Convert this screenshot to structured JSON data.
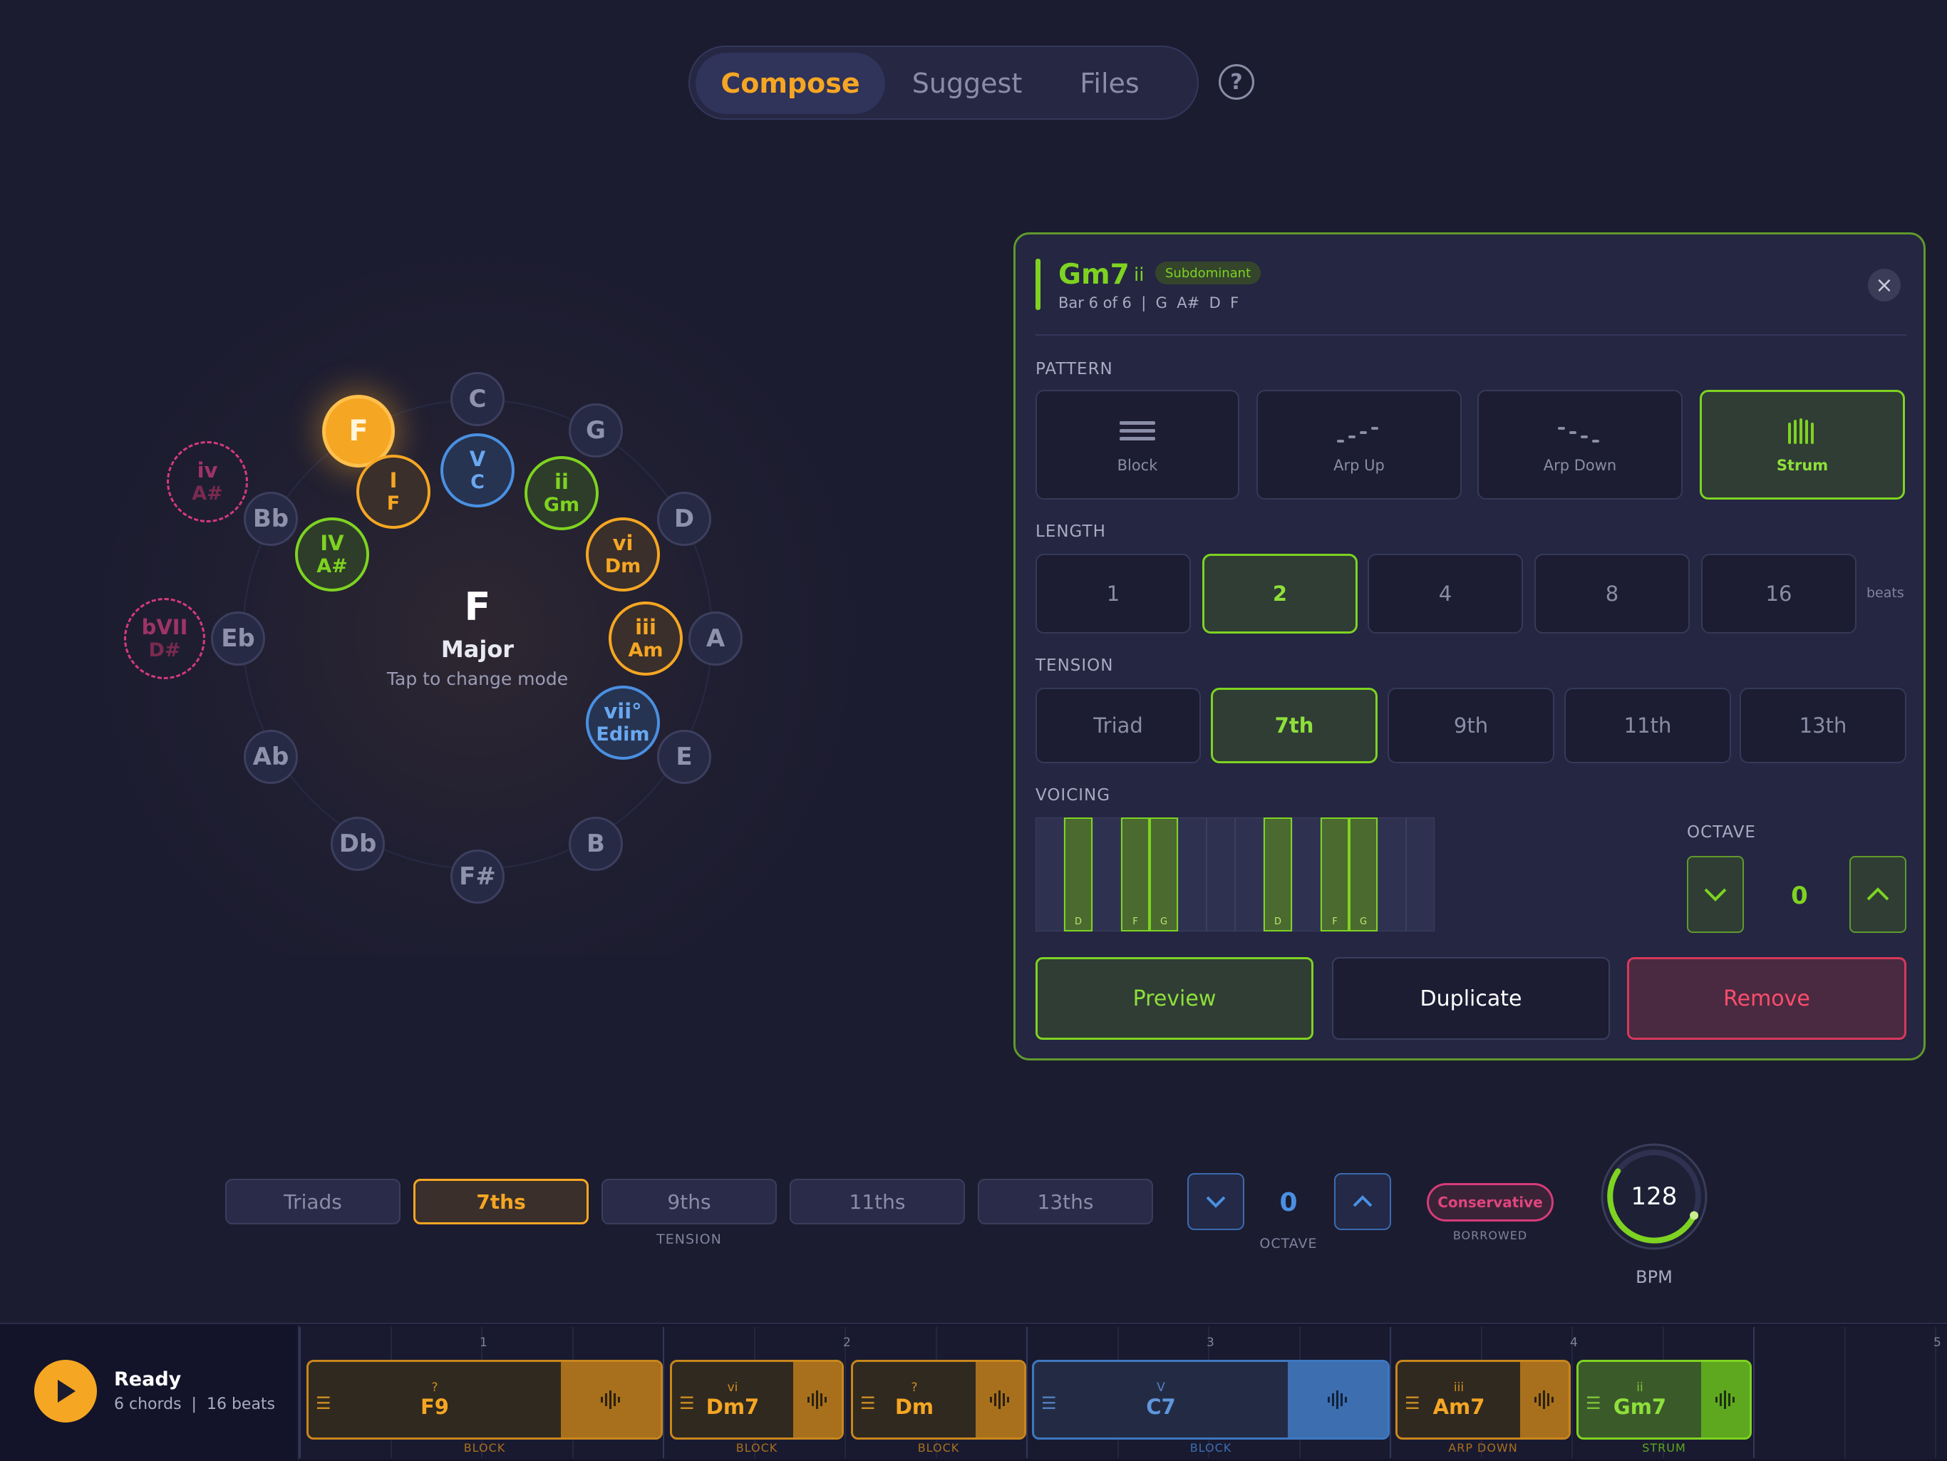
{
  "tabs": [
    {
      "label": "Compose",
      "active": true
    },
    {
      "label": "Suggest",
      "active": false
    },
    {
      "label": "Files",
      "active": false
    }
  ],
  "help": {
    "label": "?"
  },
  "wheel": {
    "keys": [
      "C",
      "G",
      "D",
      "A",
      "E",
      "B",
      "F#",
      "Db",
      "Ab",
      "Eb",
      "Bb",
      "F"
    ],
    "degrees": [
      {
        "roman": "I",
        "chord": "F",
        "color": "orange"
      },
      {
        "roman": "V",
        "chord": "C",
        "color": "blue"
      },
      {
        "roman": "ii",
        "chord": "Gm",
        "color": "green"
      },
      {
        "roman": "vi",
        "chord": "Dm",
        "color": "orange"
      },
      {
        "roman": "iii",
        "chord": "Am",
        "color": "orange"
      },
      {
        "roman": "vii°",
        "chord": "Edim",
        "color": "blue"
      },
      {
        "roman": "IV",
        "chord": "A#",
        "color": "green"
      },
      {
        "roman": "iv",
        "chord": "A#",
        "color": "pink"
      },
      {
        "roman": "bVII",
        "chord": "D#",
        "color": "pink"
      }
    ],
    "center": {
      "key": "F",
      "mode": "Major",
      "hint": "Tap to change mode"
    }
  },
  "panel": {
    "chord": "Gm7",
    "roman": "ii",
    "function": "Subdominant",
    "bar_info": "Bar 6 of 6  |  G  A#  D  F",
    "close": "×",
    "pattern_label": "PATTERN",
    "patterns": [
      {
        "name": "Block"
      },
      {
        "name": "Arp Up"
      },
      {
        "name": "Arp Down"
      },
      {
        "name": "Strum",
        "selected": true
      }
    ],
    "length_label": "LENGTH",
    "lengths": [
      "1",
      "2",
      "4",
      "8",
      "16"
    ],
    "length_selected": "2",
    "length_unit": "beats",
    "tension_label": "TENSION",
    "tensions": [
      "Triad",
      "7th",
      "9th",
      "11th",
      "13th"
    ],
    "tension_selected": "7th",
    "voicing_label": "VOICING",
    "voicing_notes": [
      "D",
      "F",
      "G",
      "D",
      "F",
      "G"
    ],
    "octave_label": "OCTAVE",
    "octave_value": "0",
    "actions": {
      "preview": "Preview",
      "duplicate": "Duplicate",
      "remove": "Remove"
    }
  },
  "controls": {
    "tension_presets": [
      "Triads",
      "7ths",
      "9ths",
      "11ths",
      "13ths"
    ],
    "tension_selected": "7ths",
    "tension_caption": "TENSION",
    "octave_value": "0",
    "octave_caption": "OCTAVE",
    "borrowed_value": "Conservative",
    "borrowed_caption": "BORROWED",
    "bpm": "128",
    "bpm_caption": "BPM",
    "bpm_fraction": 0.62
  },
  "transport": {
    "status": "Ready",
    "summary": "6 chords  |  16 beats"
  },
  "timeline": {
    "bar_numbers": [
      "1",
      "2",
      "3",
      "4",
      "5"
    ],
    "chords": [
      {
        "roman": "?",
        "name": "F9",
        "pattern": "BLOCK",
        "color": "orange"
      },
      {
        "roman": "vi",
        "name": "Dm7",
        "pattern": "BLOCK",
        "color": "orange"
      },
      {
        "roman": "?",
        "name": "Dm",
        "pattern": "BLOCK",
        "color": "orange"
      },
      {
        "roman": "V",
        "name": "C7",
        "pattern": "BLOCK",
        "color": "blue"
      },
      {
        "roman": "iii",
        "name": "Am7",
        "pattern": "ARP DOWN",
        "color": "orange"
      },
      {
        "roman": "ii",
        "name": "Gm7",
        "pattern": "STRUM",
        "color": "green"
      }
    ]
  },
  "colors": {
    "orange": "#f5a623",
    "green": "#7ed321",
    "blue": "#4a90e2",
    "pink": "#d63b7a",
    "background": "#1c1c30"
  }
}
